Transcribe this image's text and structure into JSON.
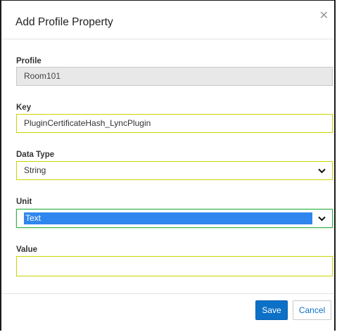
{
  "dialog": {
    "title": "Add Profile Property",
    "close_icon": "close-icon"
  },
  "form": {
    "profile": {
      "label": "Profile",
      "value": "Room101"
    },
    "key": {
      "label": "Key",
      "value": "PluginCertificateHash_LyncPlugin"
    },
    "data_type": {
      "label": "Data Type",
      "value": "String",
      "icon": "chevron-down-icon"
    },
    "unit": {
      "label": "Unit",
      "value": "Text",
      "icon": "chevron-down-icon"
    },
    "value": {
      "label": "Value",
      "value": ""
    }
  },
  "footer": {
    "save_label": "Save",
    "cancel_label": "Cancel"
  },
  "colors": {
    "primary": "#0b70c6",
    "field_border": "#c9d400",
    "selection": "#2f86ef"
  }
}
